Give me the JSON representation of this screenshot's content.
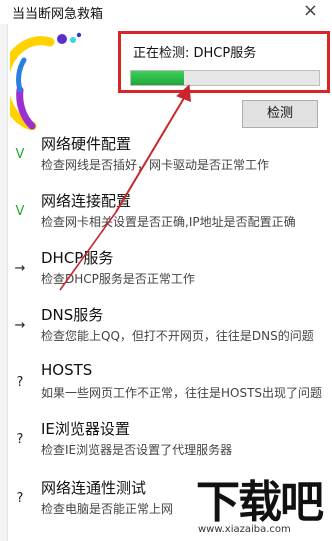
{
  "window": {
    "title": "当当断网急救箱",
    "close_glyph": "×"
  },
  "status": {
    "text": "正在检测: DHCP服务",
    "progress": 0.28,
    "progress_color": "#2ebf4b",
    "highlight_color": "#d9242a"
  },
  "detect_button": {
    "label": "检测"
  },
  "items": [
    {
      "mark": "V",
      "mark_type": "ok",
      "label": "网络硬件配置",
      "desc": "检查网线是否插好，网卡驱动是否正常工作"
    },
    {
      "mark": "V",
      "mark_type": "ok",
      "label": "网络连接配置",
      "desc": "检查网卡相关设置是否正确,IP地址是否配置正确"
    },
    {
      "mark": "→",
      "mark_type": "arrow",
      "label": "DHCP服务",
      "desc": "检查DHCP服务是否正常工作"
    },
    {
      "mark": "→",
      "mark_type": "arrow",
      "label": "DNS服务",
      "desc": "检查您能上QQ，但打不开网页，往往是DNS的问题"
    },
    {
      "mark": "?",
      "mark_type": "q",
      "label": "HOSTS",
      "desc": "如果一些网页工作不正常，往往是HOSTS出现了问题"
    },
    {
      "mark": "?",
      "mark_type": "q",
      "label": "IE浏览器设置",
      "desc": "检查IE浏览器是否设置了代理服务器"
    },
    {
      "mark": "?",
      "mark_type": "q",
      "label": "网络连通性测试",
      "desc": "检查电脑是否能正常上网"
    }
  ],
  "watermark": {
    "text": "下载吧",
    "url": "www.xiazaiba.com"
  }
}
